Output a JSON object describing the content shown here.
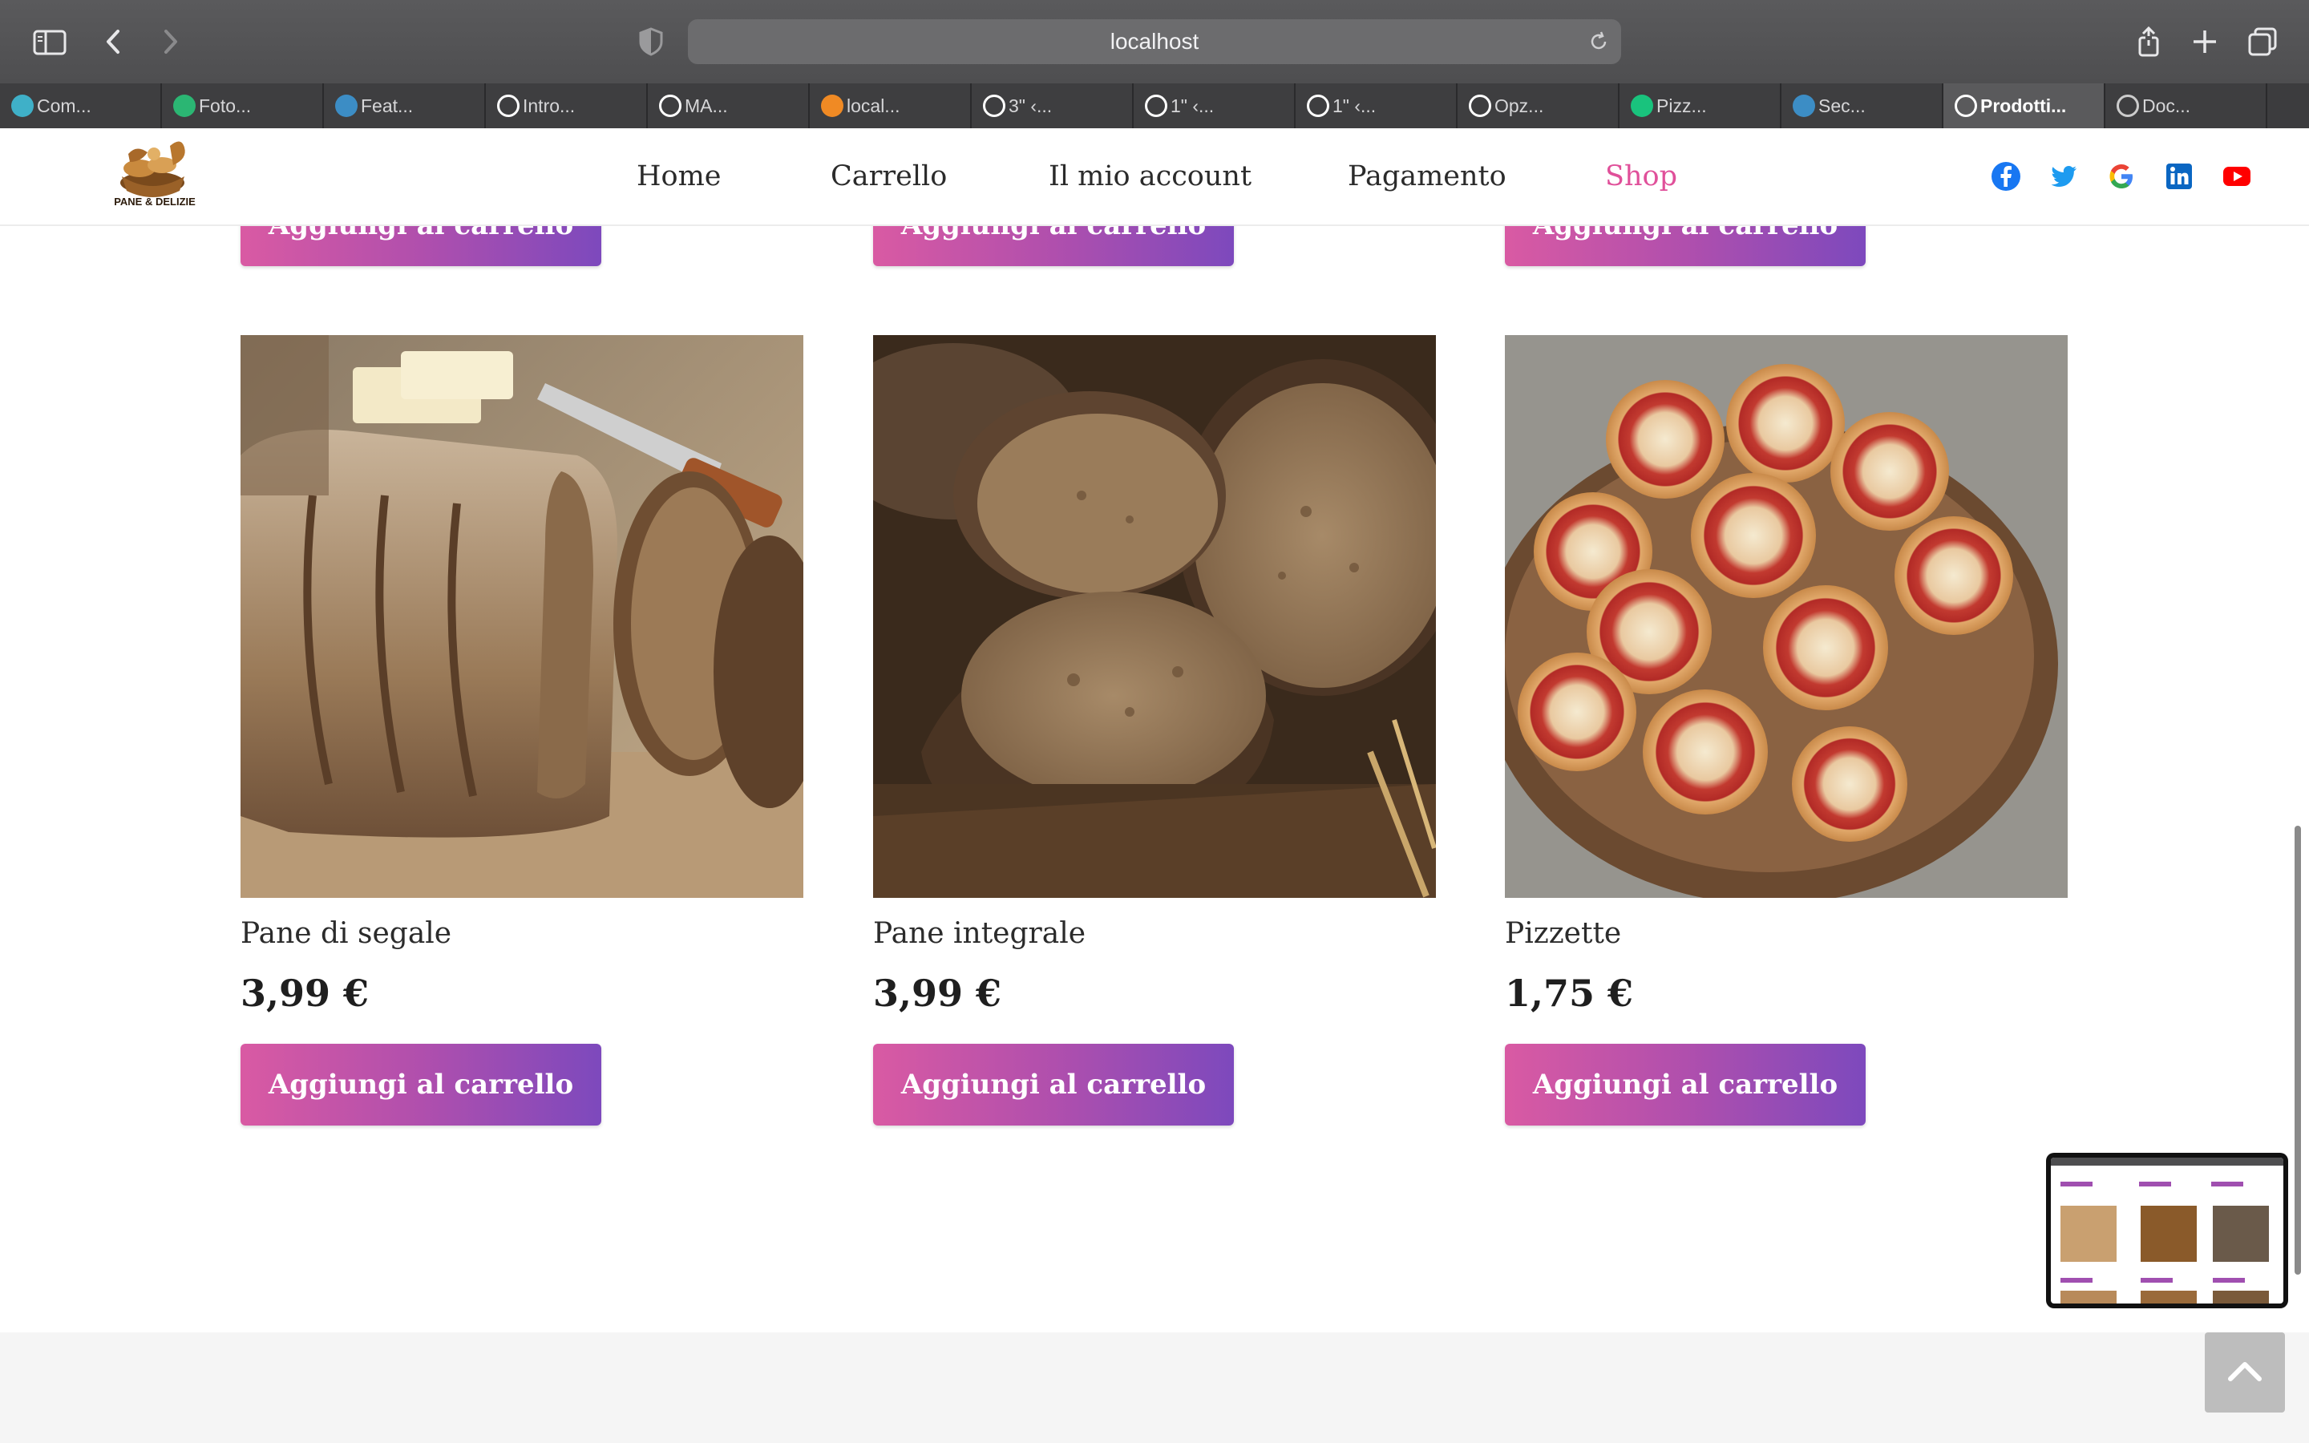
{
  "browser": {
    "url": "localhost",
    "tabs": [
      {
        "label": "Com...",
        "icon": "cloud-icon",
        "color": "#3fb0c8"
      },
      {
        "label": "Foto...",
        "icon": "p-letter-icon",
        "color": "#2bb673"
      },
      {
        "label": "Feat...",
        "icon": "wordpress-icon",
        "color": "#3c8dc5"
      },
      {
        "label": "Intro...",
        "icon": "openai-icon",
        "color": "#ffffff"
      },
      {
        "label": "MA...",
        "icon": "elephant-icon",
        "color": "#ffffff"
      },
      {
        "label": "local...",
        "icon": "xampp-icon",
        "color": "#f08a24"
      },
      {
        "label": "3\" ‹...",
        "icon": "elephant-icon",
        "color": "#ffffff"
      },
      {
        "label": "1\" ‹...",
        "icon": "elephant-icon",
        "color": "#ffffff"
      },
      {
        "label": "1\" ‹...",
        "icon": "elephant-icon",
        "color": "#ffffff"
      },
      {
        "label": "Opz...",
        "icon": "elephant-icon",
        "color": "#ffffff"
      },
      {
        "label": "Pizz...",
        "icon": "chatgpt-icon",
        "color": "#19c37d"
      },
      {
        "label": "Sec...",
        "icon": "wordpress-icon",
        "color": "#3c8dc5"
      },
      {
        "label": "Prodotti...",
        "icon": "elephant-icon",
        "color": "#ffffff",
        "active": true
      },
      {
        "label": "Doc...",
        "icon": "compass-icon",
        "color": "#cccccc"
      }
    ]
  },
  "site": {
    "logo_text": "PANE & DELIZIE",
    "nav": [
      "Home",
      "Carrello",
      "Il mio account",
      "Pagamento",
      "Shop"
    ],
    "active_nav": "Shop",
    "social": [
      "facebook-icon",
      "twitter-icon",
      "google-icon",
      "linkedin-icon",
      "youtube-icon"
    ],
    "accent_color": "#e0509a",
    "button_gradient": [
      "#d95aa3",
      "#7d49bd"
    ]
  },
  "top_row_buttons": [
    "Aggiungi al carrello",
    "Aggiungi al carrello",
    "Aggiungi al carrello"
  ],
  "products": [
    {
      "name": "Pane di segale",
      "price": "3,99 €",
      "button": "Aggiungi al carrello",
      "image": "rye-bread-photo"
    },
    {
      "name": "Pane integrale",
      "price": "3,99 €",
      "button": "Aggiungi al carrello",
      "image": "wholegrain-bread-photo"
    },
    {
      "name": "Pizzette",
      "price": "1,75 €",
      "button": "Aggiungi al carrello",
      "image": "mini-pizzas-photo"
    }
  ]
}
